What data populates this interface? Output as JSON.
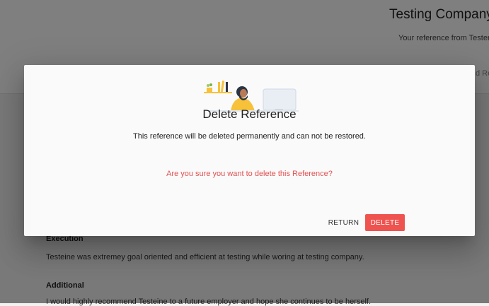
{
  "background": {
    "company_title": "Testing Company",
    "reference_from": "Your reference from Tester",
    "header_right_text": "d Re",
    "sections": [
      {
        "title": "Execution",
        "text": "Testeine was extremey goal oriented and efficient at testing while woring at testing company."
      },
      {
        "title": "Additional",
        "text": "I would highly recommend Testeine to a future employer and hope she continues to be herself."
      }
    ]
  },
  "dialog": {
    "title": "Delete Reference",
    "body": "This reference will be deleted permanently and can not be restored.",
    "warning": "Are you sure you want to delete this Reference?",
    "return_label": "RETURN",
    "delete_label": "DELETE",
    "colors": {
      "delete_button": "#ef5350",
      "warning_text": "#e05252",
      "illustration_yellow": "#f7c23a",
      "illustration_dark": "#2b3544"
    }
  }
}
